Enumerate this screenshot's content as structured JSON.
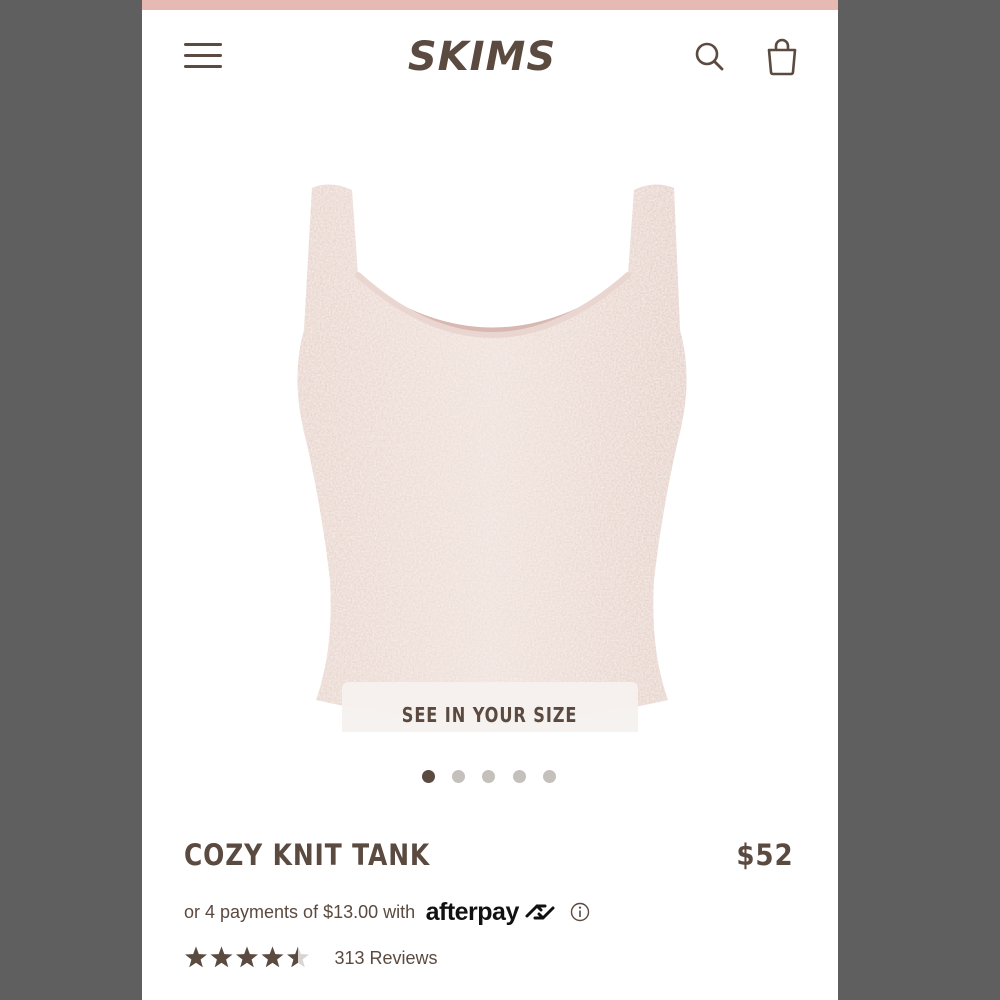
{
  "header": {
    "logo_text": "SKIMS",
    "menu_icon": "hamburger-menu-icon",
    "search_icon": "search-icon",
    "bag_icon": "shopping-bag-icon"
  },
  "product": {
    "image_description_icon": "product-photo",
    "see_in_your_size_label": "SEE IN YOUR SIZE",
    "carousel": {
      "total_slides": 5,
      "active_index": 0
    },
    "title": "COZY KNIT TANK",
    "price": "$52",
    "afterpay": {
      "text": "or 4 payments of $13.00 with",
      "brand": "afterpay",
      "info_icon": "info-circle-icon"
    },
    "rating": {
      "value": 4.5,
      "max": 5,
      "reviews_label": "313 Reviews"
    }
  },
  "colors": {
    "accent_strip": "#e6b9b3",
    "text_brown": "#5a4a40",
    "dot_inactive": "#c4c0bc",
    "dot_active": "#5a4a40",
    "star_filled": "#5a4a40",
    "star_empty": "#d8d4d0",
    "backdrop": "#5f5f5f"
  }
}
